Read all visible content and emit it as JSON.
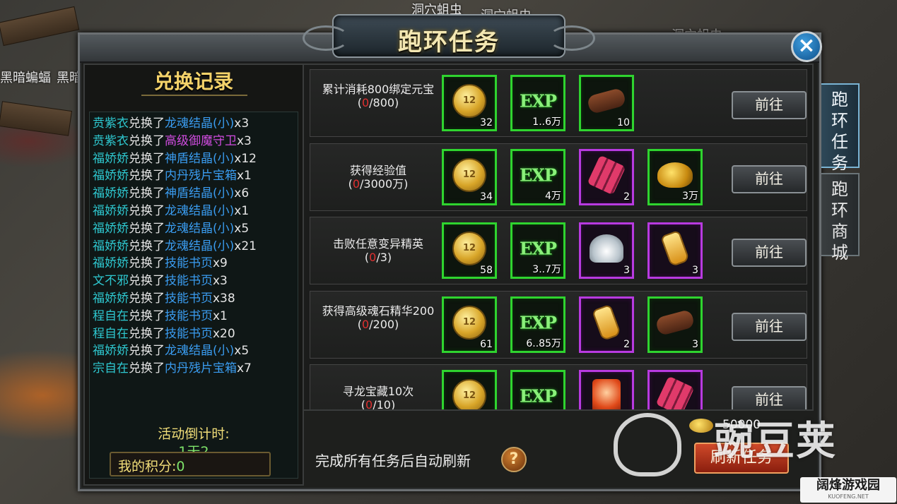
{
  "scene": {
    "labels": [
      "洞穴蛆虫",
      "洞穴蛆虫",
      "洞穴蛆虫",
      "黑暗蝙蝠",
      "黑暗"
    ]
  },
  "window": {
    "title": "跑环任务",
    "close_icon": "×"
  },
  "records_panel": {
    "title": "兑换记录",
    "records": [
      {
        "user": "贲紫衣",
        "verb": "兑换了",
        "item": "龙魂结晶(小)",
        "qty": "x3",
        "color": "blue"
      },
      {
        "user": "贲紫衣",
        "verb": "兑换了",
        "item": "高级御魔守卫",
        "qty": "x3",
        "color": "purple"
      },
      {
        "user": "福娇娇",
        "verb": "兑换了",
        "item": "神盾结晶(小)",
        "qty": "x12",
        "color": "blue"
      },
      {
        "user": "福娇娇",
        "verb": "兑换了",
        "item": "内丹残片宝箱",
        "qty": "x1",
        "color": "blue"
      },
      {
        "user": "福娇娇",
        "verb": "兑换了",
        "item": "神盾结晶(小)",
        "qty": "x6",
        "color": "blue"
      },
      {
        "user": "福娇娇",
        "verb": "兑换了",
        "item": "龙魂结晶(小)",
        "qty": "x1",
        "color": "blue"
      },
      {
        "user": "福娇娇",
        "verb": "兑换了",
        "item": "龙魂结晶(小)",
        "qty": "x5",
        "color": "blue"
      },
      {
        "user": "福娇娇",
        "verb": "兑换了",
        "item": "龙魂结晶(小)",
        "qty": "x21",
        "color": "blue"
      },
      {
        "user": "福娇娇",
        "verb": "兑换了",
        "item": "技能书页",
        "qty": "x9",
        "color": "blue"
      },
      {
        "user": "文不邪",
        "verb": "兑换了",
        "item": "技能书页",
        "qty": "x3",
        "color": "blue"
      },
      {
        "user": "福娇娇",
        "verb": "兑换了",
        "item": "技能书页",
        "qty": "x38",
        "color": "blue"
      },
      {
        "user": "程自在",
        "verb": "兑换了",
        "item": "技能书页",
        "qty": "x1",
        "color": "blue"
      },
      {
        "user": "程自在",
        "verb": "兑换了",
        "item": "技能书页",
        "qty": "x20",
        "color": "blue"
      },
      {
        "user": "福娇娇",
        "verb": "兑换了",
        "item": "龙魂结晶(小)",
        "qty": "x5",
        "color": "blue"
      },
      {
        "user": "宗自在",
        "verb": "兑换了",
        "item": "内丹残片宝箱",
        "qty": "x7",
        "color": "blue"
      }
    ],
    "countdown_label": "活动倒计时:",
    "countdown_value": "1天2",
    "score_label": "我的积分:",
    "score_value": "0"
  },
  "tasks": [
    {
      "title": "累计消耗800绑定元宝",
      "progress_current": "0",
      "progress_total": "/800)",
      "rewards": [
        {
          "icon": "coin-icon",
          "qty": "32",
          "quality": "green"
        },
        {
          "icon": "exp-icon",
          "qty": "1..6万",
          "quality": "green"
        },
        {
          "icon": "wood-icon",
          "qty": "10",
          "quality": "green"
        }
      ],
      "button": "前往"
    },
    {
      "title": "获得经验值",
      "progress_current": "0",
      "progress_total": "/3000万)",
      "rewards": [
        {
          "icon": "coin-icon",
          "qty": "34",
          "quality": "green"
        },
        {
          "icon": "exp-icon",
          "qty": "4万",
          "quality": "green"
        },
        {
          "icon": "firecracker-icon",
          "qty": "2",
          "quality": "purple"
        },
        {
          "icon": "gold-pile-icon",
          "qty": "3万",
          "quality": "green"
        }
      ],
      "button": "前往"
    },
    {
      "title": "击败任意变异精英",
      "progress_current": "0",
      "progress_total": "/3)",
      "rewards": [
        {
          "icon": "coin-icon",
          "qty": "58",
          "quality": "green"
        },
        {
          "icon": "exp-icon",
          "qty": "3..7万",
          "quality": "green"
        },
        {
          "icon": "lotus-icon",
          "qty": "3",
          "quality": "purple"
        },
        {
          "icon": "bottle-icon",
          "qty": "3",
          "quality": "purple"
        }
      ],
      "button": "前往"
    },
    {
      "title": "获得高级魂石精华200",
      "progress_current": "0",
      "progress_total": "/200)",
      "rewards": [
        {
          "icon": "coin-icon",
          "qty": "61",
          "quality": "green"
        },
        {
          "icon": "exp-icon",
          "qty": "6..85万",
          "quality": "green"
        },
        {
          "icon": "bottle-icon",
          "qty": "2",
          "quality": "purple"
        },
        {
          "icon": "wood-icon",
          "qty": "3",
          "quality": "green"
        }
      ],
      "button": "前往"
    },
    {
      "title": "寻龙宝藏10次",
      "progress_current": "0",
      "progress_total": "/10)",
      "rewards": [
        {
          "icon": "coin-icon",
          "qty": "",
          "quality": "green"
        },
        {
          "icon": "exp-icon",
          "qty": "",
          "quality": "green"
        },
        {
          "icon": "talisman-icon",
          "qty": "",
          "quality": "purple"
        },
        {
          "icon": "firecracker-icon",
          "qty": "",
          "quality": "purple"
        }
      ],
      "button": "前往"
    }
  ],
  "side_tabs": [
    {
      "label": "跑环任务",
      "active": true
    },
    {
      "label": "跑环商城",
      "active": false
    }
  ],
  "footer": {
    "auto_refresh_text": "完成所有任务后自动刷新",
    "help_icon": "?",
    "refresh_cost": "50000",
    "refresh_button": "刷新任务"
  },
  "watermarks": {
    "main": "豌豆荚",
    "site": "阔烽游戏园",
    "site_sub": "KUOFENG.NET"
  },
  "colors": {
    "user_name": "#2ec8d0",
    "item_blue": "#3a9cf0",
    "item_purple": "#d04ce0",
    "progress_current": "#e03030",
    "slot_green": "#2fd42f",
    "slot_purple": "#b83ae0"
  }
}
